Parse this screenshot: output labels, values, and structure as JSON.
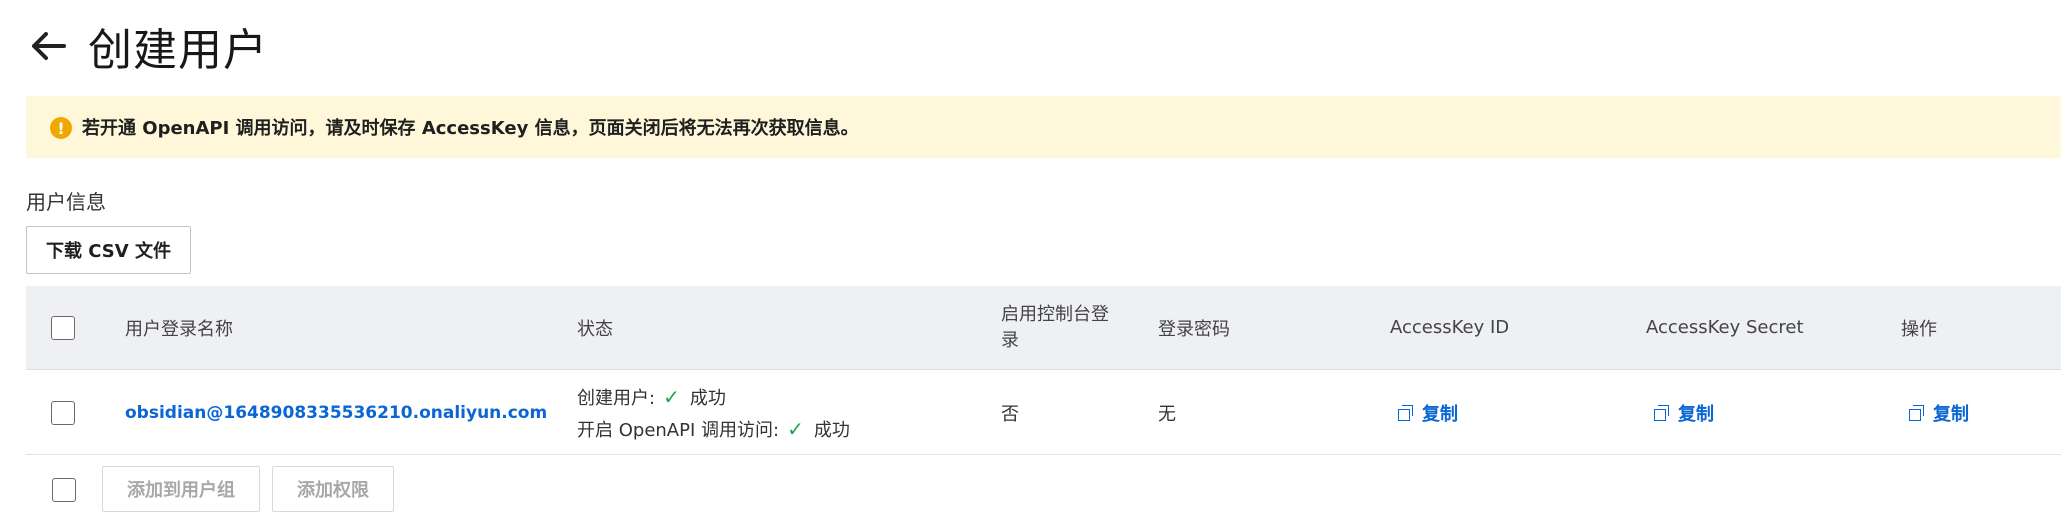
{
  "header": {
    "back_icon": "arrow-left-icon",
    "title": "创建用户"
  },
  "alert": {
    "icon": "warning-icon",
    "icon_glyph": "!",
    "text": "若开通 OpenAPI 调用访问，请及时保存 AccessKey 信息，页面关闭后将无法再次获取信息。",
    "background": "#fff7d9",
    "icon_color": "#f0a800"
  },
  "section": {
    "title": "用户信息",
    "download_label": "下载 CSV 文件"
  },
  "table": {
    "columns": {
      "login_name": "用户登录名称",
      "status": "状态",
      "console_login": "启用控制台登录",
      "password": "登录密码",
      "access_key_id": "AccessKey ID",
      "access_key_secret": "AccessKey Secret",
      "actions": "操作"
    },
    "rows": [
      {
        "login_name": "obsidian@1648908335536210.onaliyun.com",
        "status": {
          "create_user_label": "创建用户:",
          "create_user_result": "成功",
          "openapi_label": "开启 OpenAPI 调用访问:",
          "openapi_result": "成功"
        },
        "console_login": "否",
        "password": "无",
        "access_key_id_action": "复制",
        "access_key_secret_action": "复制",
        "actions_copy": "复制"
      }
    ],
    "check_glyph": "✓"
  },
  "footer": {
    "add_to_group_label": "添加到用户组",
    "add_permission_label": "添加权限"
  },
  "colors": {
    "link": "#0a66d4",
    "success": "#22a34a",
    "header_bg": "#eef0f4"
  }
}
